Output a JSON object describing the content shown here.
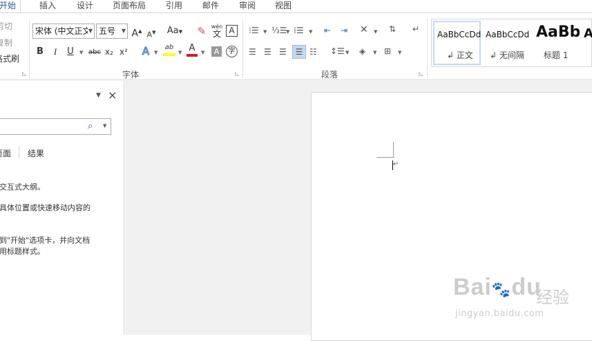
{
  "tabs": [
    {
      "label": "开始",
      "active": true
    },
    {
      "label": "插入"
    },
    {
      "label": "设计"
    },
    {
      "label": "页面布局"
    },
    {
      "label": "引用"
    },
    {
      "label": "邮件"
    },
    {
      "label": "审阅"
    },
    {
      "label": "视图"
    }
  ],
  "clipboard": {
    "cut": "剪切",
    "copy": "复制",
    "format_painter": "格式刷"
  },
  "font": {
    "name": "宋体 (中文正文",
    "size": "五号",
    "group_label": "字体",
    "bold": "B",
    "italic": "I",
    "underline": "U",
    "strike": "abc",
    "subscript": "x₂",
    "superscript": "x²",
    "change_case": "Aa",
    "phonetic_top": "wén",
    "phonetic_bottom": "文",
    "char_border": "A",
    "text_effects": "A",
    "highlight": "ab",
    "font_color": "A",
    "char_shading": "A",
    "enclose": "字",
    "grow": "A",
    "shrink": "A"
  },
  "paragraph": {
    "group_label": "段落"
  },
  "styles": {
    "items": [
      {
        "preview": "AaBbCcDd",
        "label": "正文",
        "selected": true
      },
      {
        "preview": "AaBbCcDd",
        "label": "无间隔"
      },
      {
        "preview": "AaBb",
        "label": "标题 1"
      },
      {
        "preview": "A",
        "label": ""
      }
    ]
  },
  "nav_pane": {
    "close": "×",
    "tab_pages": "页面",
    "tab_results": "结果",
    "hint_lines": [
      "向交互式大纲。",
      "的具体位置或快速移动内容的",
      "",
      "转到\"开始\"选项卡，并向文档",
      "应用标题样式。"
    ]
  },
  "watermark": {
    "brand_left": "Bai",
    "brand_mid": "du",
    "brand_cn": "经验",
    "url": "jingyan.baidu.com"
  },
  "colors": {
    "accent": "#2b579a",
    "highlight": "#ffff00",
    "font_red": "#e0161e",
    "icon_blue": "#3572b0"
  }
}
